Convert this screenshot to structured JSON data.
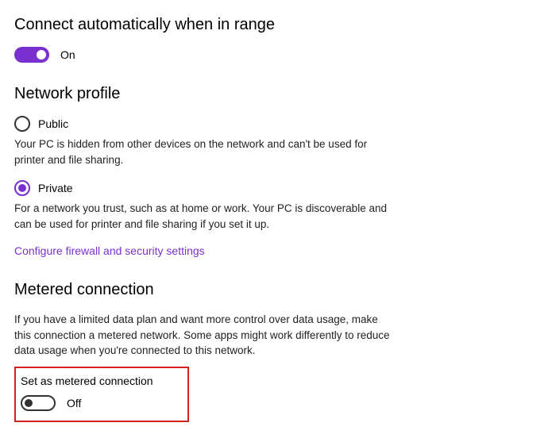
{
  "autoConnect": {
    "title": "Connect automatically when in range",
    "toggleState": "On"
  },
  "networkProfile": {
    "title": "Network profile",
    "public": {
      "label": "Public",
      "desc": "Your PC is hidden from other devices on the network and can't be used for printer and file sharing."
    },
    "private": {
      "label": "Private",
      "desc": "For a network you trust, such as at home or work. Your PC is discoverable and can be used for printer and file sharing if you set it up."
    },
    "link": "Configure firewall and security settings"
  },
  "metered": {
    "title": "Metered connection",
    "desc": "If you have a limited data plan and want more control over data usage, make this connection a metered network. Some apps might work differently to reduce data usage when you're connected to this network.",
    "setLabel": "Set as metered connection",
    "toggleState": "Off"
  }
}
